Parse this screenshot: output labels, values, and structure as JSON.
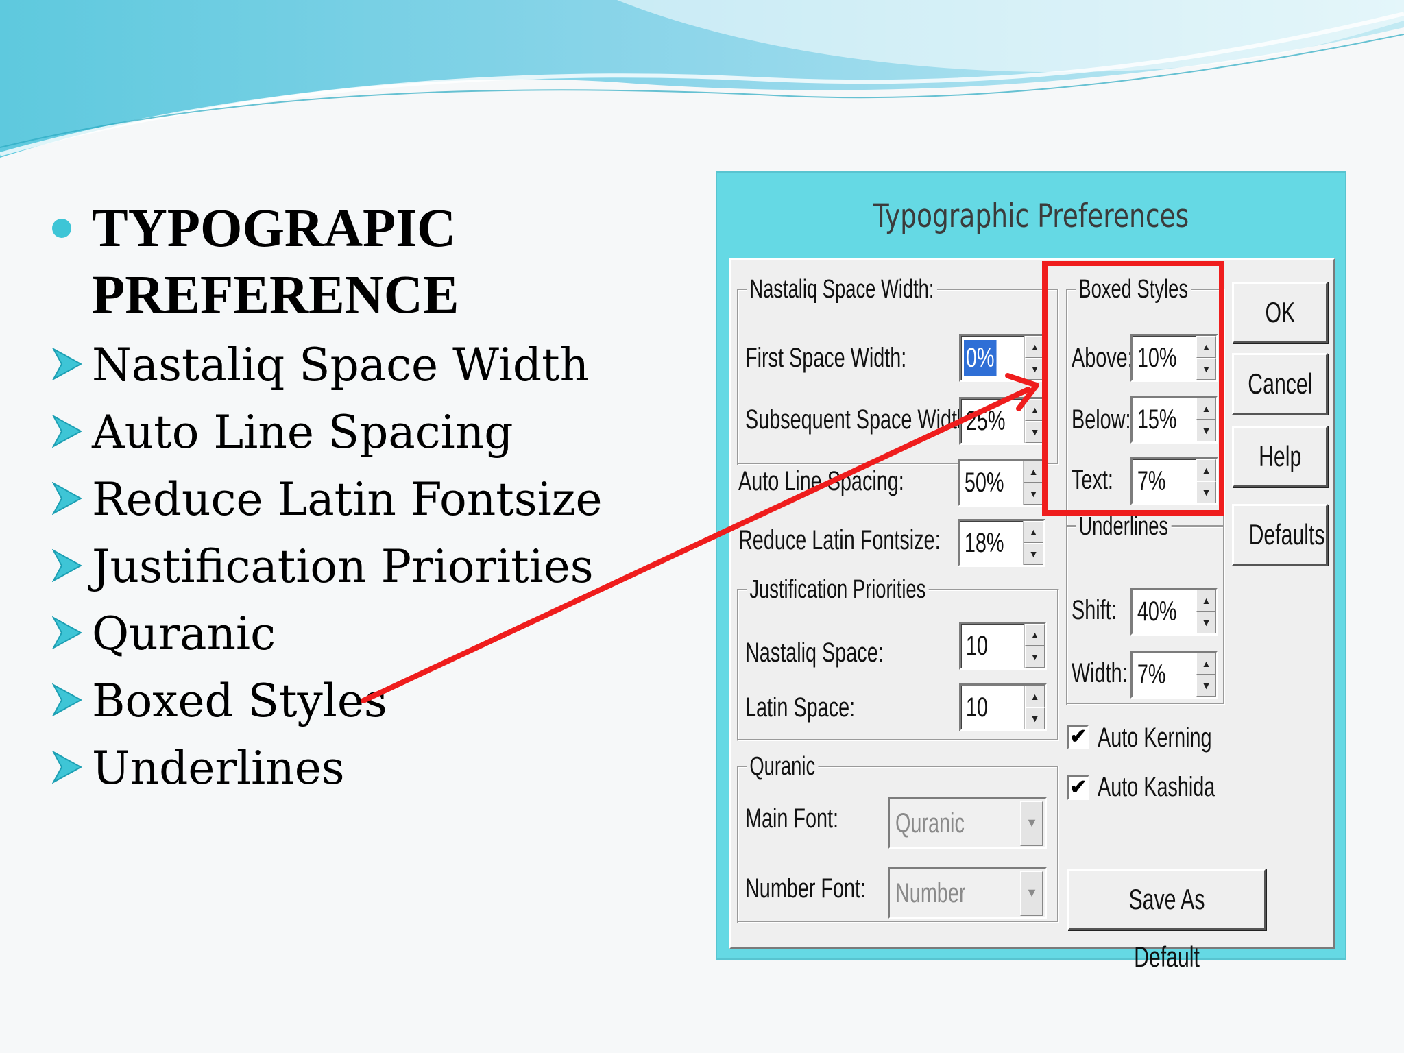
{
  "slide": {
    "heading": "TYPOGRAPIC PREFERENCE",
    "bullets": [
      "Nastaliq Space Width",
      "Auto Line Spacing",
      "Reduce Latin Fontsize",
      "Justification Priorities",
      "Quranic",
      "Boxed Styles",
      "Underlines"
    ],
    "accent_color": "#3ec5d6",
    "arrow_color": "#ef1d1d"
  },
  "dialog": {
    "title": "Typographic Preferences",
    "nastaliq": {
      "legend": "Nastaliq Space Width:",
      "first_label": "First Space Width:",
      "first_value": "0%",
      "subsequent_label": "Subsequent Space Width:",
      "subsequent_value": "25%"
    },
    "auto_line_label": "Auto Line Spacing:",
    "auto_line_value": "50%",
    "reduce_latin_label": "Reduce Latin Fontsize:",
    "reduce_latin_value": "18%",
    "justification": {
      "legend": "Justification Priorities",
      "nastaliq_label": "Nastaliq Space:",
      "nastaliq_value": "10",
      "latin_label": "Latin Space:",
      "latin_value": "10"
    },
    "quranic": {
      "legend": "Quranic",
      "main_label": "Main Font:",
      "main_value": "Quranic",
      "number_label": "Number Font:",
      "number_value": "Number"
    },
    "boxed": {
      "legend": "Boxed Styles",
      "above_label": "Above:",
      "above_value": "10%",
      "below_label": "Below:",
      "below_value": "15%",
      "text_label": "Text:",
      "text_value": "7%"
    },
    "underlines": {
      "legend": "Underlines",
      "shift_label": "Shift:",
      "shift_value": "40%",
      "width_label": "Width:",
      "width_value": "7%"
    },
    "checkboxes": [
      {
        "label": "Auto Kerning",
        "checked": true
      },
      {
        "label": "Auto Kashida",
        "checked": true
      }
    ],
    "buttons": {
      "ok": "OK",
      "cancel": "Cancel",
      "help": "Help",
      "defaults": "Defaults",
      "save_default": "Save As Default"
    },
    "check_mark": "✔",
    "spin_up": "▲",
    "spin_down": "▼",
    "drop_arrow": "▼"
  }
}
